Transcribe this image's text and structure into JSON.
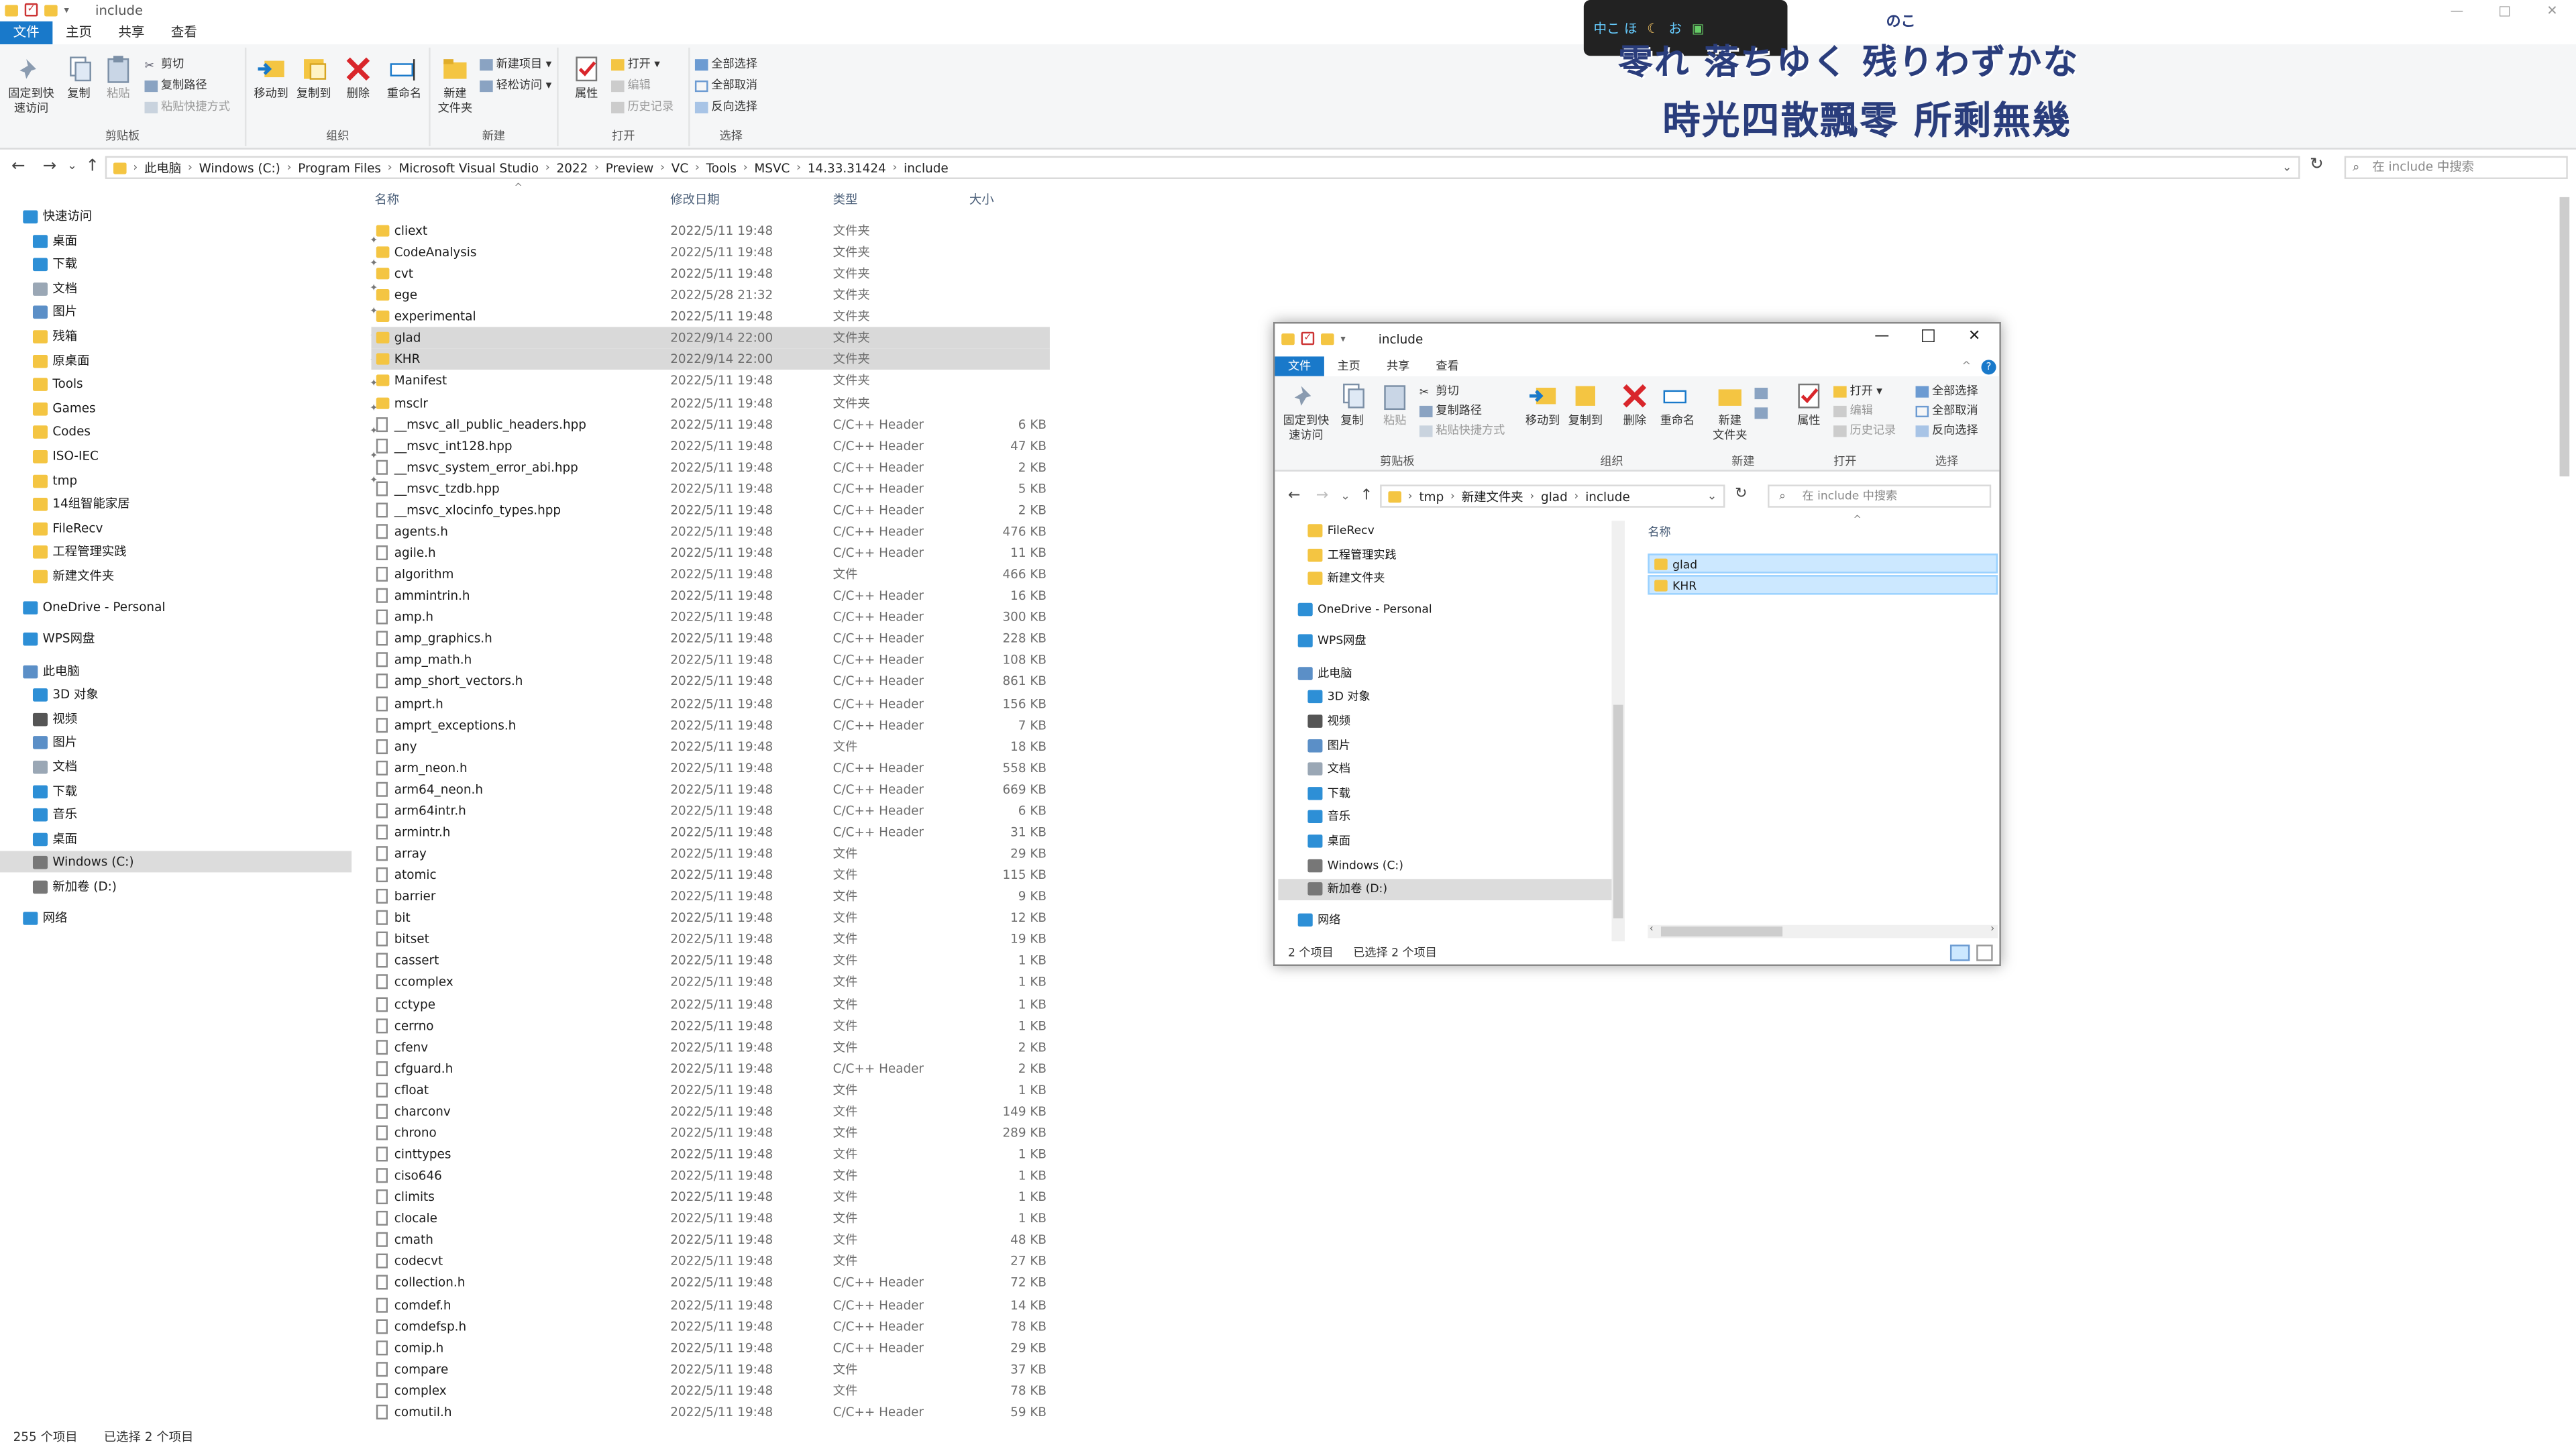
{
  "window": {
    "title": "include"
  },
  "ribbon_tabs": [
    "文件",
    "主页",
    "共享",
    "查看"
  ],
  "ribbon": {
    "clipboard": {
      "label": "剪贴板",
      "pin": "固定到快\n速访问",
      "copy": "复制",
      "paste": "粘贴",
      "cut": "剪切",
      "copy_path": "复制路径",
      "paste_shortcut": "粘贴快捷方式"
    },
    "organize": {
      "label": "组织",
      "move_to": "移动到",
      "copy_to": "复制到",
      "delete": "删除",
      "rename": "重命名"
    },
    "new": {
      "label": "新建",
      "new_folder": "新建\n文件夹",
      "new_item": "新建项目 ▾",
      "easy_access": "轻松访问 ▾"
    },
    "open": {
      "label": "打开",
      "properties": "属性",
      "open": "打开 ▾",
      "edit": "编辑",
      "history": "历史记录"
    },
    "select": {
      "label": "选择",
      "select_all": "全部选择",
      "select_none": "全部取消",
      "invert": "反向选择"
    }
  },
  "address": {
    "crumbs": [
      "此电脑",
      "Windows (C:)",
      "Program Files",
      "Microsoft Visual Studio",
      "2022",
      "Preview",
      "VC",
      "Tools",
      "MSVC",
      "14.33.31424",
      "include"
    ],
    "search_placeholder": "在 include 中搜索"
  },
  "sidebar": {
    "quick_access": "快速访问",
    "pinned": [
      {
        "label": "桌面",
        "icon": "desktop-icon"
      },
      {
        "label": "下载",
        "icon": "download-icon"
      },
      {
        "label": "文档",
        "icon": "document-icon"
      },
      {
        "label": "图片",
        "icon": "picture-icon"
      },
      {
        "label": "残箱",
        "icon": "folder-icon"
      },
      {
        "label": "原桌面",
        "icon": "folder-icon"
      },
      {
        "label": "Tools",
        "icon": "folder-icon"
      },
      {
        "label": "Games",
        "icon": "folder-icon"
      },
      {
        "label": "Codes",
        "icon": "folder-icon"
      },
      {
        "label": "ISO-IEC",
        "icon": "folder-icon"
      },
      {
        "label": "tmp",
        "icon": "folder-icon"
      }
    ],
    "unpinned": [
      "14组智能家居",
      "FileRecv",
      "工程管理实践",
      "新建文件夹"
    ],
    "onedrive": "OneDrive - Personal",
    "wps": "WPS网盘",
    "this_pc": "此电脑",
    "pc_items": [
      "3D 对象",
      "视频",
      "图片",
      "文档",
      "下载",
      "音乐",
      "桌面",
      "Windows (C:)",
      "新加卷 (D:)"
    ],
    "network": "网络"
  },
  "columns": {
    "name": "名称",
    "date": "修改日期",
    "type": "类型",
    "size": "大小"
  },
  "files": [
    [
      "cliext",
      "2022/5/11 19:48",
      "文件夹",
      "",
      "d"
    ],
    [
      "CodeAnalysis",
      "2022/5/11 19:48",
      "文件夹",
      "",
      "d"
    ],
    [
      "cvt",
      "2022/5/11 19:48",
      "文件夹",
      "",
      "d"
    ],
    [
      "ege",
      "2022/5/28 21:32",
      "文件夹",
      "",
      "d"
    ],
    [
      "experimental",
      "2022/5/11 19:48",
      "文件夹",
      "",
      "d"
    ],
    [
      "glad",
      "2022/9/14 22:00",
      "文件夹",
      "",
      "ds"
    ],
    [
      "KHR",
      "2022/9/14 22:00",
      "文件夹",
      "",
      "ds"
    ],
    [
      "Manifest",
      "2022/5/11 19:48",
      "文件夹",
      "",
      "d"
    ],
    [
      "msclr",
      "2022/5/11 19:48",
      "文件夹",
      "",
      "d"
    ],
    [
      "__msvc_all_public_headers.hpp",
      "2022/5/11 19:48",
      "C/C++ Header",
      "6 KB",
      "f"
    ],
    [
      "__msvc_int128.hpp",
      "2022/5/11 19:48",
      "C/C++ Header",
      "47 KB",
      "f"
    ],
    [
      "__msvc_system_error_abi.hpp",
      "2022/5/11 19:48",
      "C/C++ Header",
      "2 KB",
      "f"
    ],
    [
      "__msvc_tzdb.hpp",
      "2022/5/11 19:48",
      "C/C++ Header",
      "5 KB",
      "f"
    ],
    [
      "__msvc_xlocinfo_types.hpp",
      "2022/5/11 19:48",
      "C/C++ Header",
      "2 KB",
      "f"
    ],
    [
      "agents.h",
      "2022/5/11 19:48",
      "C/C++ Header",
      "476 KB",
      "f"
    ],
    [
      "agile.h",
      "2022/5/11 19:48",
      "C/C++ Header",
      "11 KB",
      "f"
    ],
    [
      "algorithm",
      "2022/5/11 19:48",
      "文件",
      "466 KB",
      "f"
    ],
    [
      "ammintrin.h",
      "2022/5/11 19:48",
      "C/C++ Header",
      "16 KB",
      "f"
    ],
    [
      "amp.h",
      "2022/5/11 19:48",
      "C/C++ Header",
      "300 KB",
      "f"
    ],
    [
      "amp_graphics.h",
      "2022/5/11 19:48",
      "C/C++ Header",
      "228 KB",
      "f"
    ],
    [
      "amp_math.h",
      "2022/5/11 19:48",
      "C/C++ Header",
      "108 KB",
      "f"
    ],
    [
      "amp_short_vectors.h",
      "2022/5/11 19:48",
      "C/C++ Header",
      "861 KB",
      "f"
    ],
    [
      "amprt.h",
      "2022/5/11 19:48",
      "C/C++ Header",
      "156 KB",
      "f"
    ],
    [
      "amprt_exceptions.h",
      "2022/5/11 19:48",
      "C/C++ Header",
      "7 KB",
      "f"
    ],
    [
      "any",
      "2022/5/11 19:48",
      "文件",
      "18 KB",
      "f"
    ],
    [
      "arm_neon.h",
      "2022/5/11 19:48",
      "C/C++ Header",
      "558 KB",
      "f"
    ],
    [
      "arm64_neon.h",
      "2022/5/11 19:48",
      "C/C++ Header",
      "669 KB",
      "f"
    ],
    [
      "arm64intr.h",
      "2022/5/11 19:48",
      "C/C++ Header",
      "6 KB",
      "f"
    ],
    [
      "armintr.h",
      "2022/5/11 19:48",
      "C/C++ Header",
      "31 KB",
      "f"
    ],
    [
      "array",
      "2022/5/11 19:48",
      "文件",
      "29 KB",
      "f"
    ],
    [
      "atomic",
      "2022/5/11 19:48",
      "文件",
      "115 KB",
      "f"
    ],
    [
      "barrier",
      "2022/5/11 19:48",
      "文件",
      "9 KB",
      "f"
    ],
    [
      "bit",
      "2022/5/11 19:48",
      "文件",
      "12 KB",
      "f"
    ],
    [
      "bitset",
      "2022/5/11 19:48",
      "文件",
      "19 KB",
      "f"
    ],
    [
      "cassert",
      "2022/5/11 19:48",
      "文件",
      "1 KB",
      "f"
    ],
    [
      "ccomplex",
      "2022/5/11 19:48",
      "文件",
      "1 KB",
      "f"
    ],
    [
      "cctype",
      "2022/5/11 19:48",
      "文件",
      "1 KB",
      "f"
    ],
    [
      "cerrno",
      "2022/5/11 19:48",
      "文件",
      "1 KB",
      "f"
    ],
    [
      "cfenv",
      "2022/5/11 19:48",
      "文件",
      "2 KB",
      "f"
    ],
    [
      "cfguard.h",
      "2022/5/11 19:48",
      "C/C++ Header",
      "2 KB",
      "f"
    ],
    [
      "cfloat",
      "2022/5/11 19:48",
      "文件",
      "1 KB",
      "f"
    ],
    [
      "charconv",
      "2022/5/11 19:48",
      "文件",
      "149 KB",
      "f"
    ],
    [
      "chrono",
      "2022/5/11 19:48",
      "文件",
      "289 KB",
      "f"
    ],
    [
      "cinttypes",
      "2022/5/11 19:48",
      "文件",
      "1 KB",
      "f"
    ],
    [
      "ciso646",
      "2022/5/11 19:48",
      "文件",
      "1 KB",
      "f"
    ],
    [
      "climits",
      "2022/5/11 19:48",
      "文件",
      "1 KB",
      "f"
    ],
    [
      "clocale",
      "2022/5/11 19:48",
      "文件",
      "1 KB",
      "f"
    ],
    [
      "cmath",
      "2022/5/11 19:48",
      "文件",
      "48 KB",
      "f"
    ],
    [
      "codecvt",
      "2022/5/11 19:48",
      "文件",
      "27 KB",
      "f"
    ],
    [
      "collection.h",
      "2022/5/11 19:48",
      "C/C++ Header",
      "72 KB",
      "f"
    ],
    [
      "comdef.h",
      "2022/5/11 19:48",
      "C/C++ Header",
      "14 KB",
      "f"
    ],
    [
      "comdefsp.h",
      "2022/5/11 19:48",
      "C/C++ Header",
      "78 KB",
      "f"
    ],
    [
      "comip.h",
      "2022/5/11 19:48",
      "C/C++ Header",
      "29 KB",
      "f"
    ],
    [
      "compare",
      "2022/5/11 19:48",
      "文件",
      "37 KB",
      "f"
    ],
    [
      "complex",
      "2022/5/11 19:48",
      "文件",
      "78 KB",
      "f"
    ],
    [
      "comutil.h",
      "2022/5/11 19:48",
      "C/C++ Header",
      "59 KB",
      "f"
    ]
  ],
  "status": {
    "count": "255 个项目",
    "selected": "已选择 2 个项目"
  },
  "lyrics": {
    "line1": "零れ 落ちゆく 残りわずかな",
    "ruby": "のこ",
    "line2": "時光四散飄零 所剩無幾",
    "bar_left": "中こ ほ",
    "bar_mid": "お"
  },
  "window2": {
    "title": "include",
    "crumbs": [
      "tmp",
      "新建文件夹",
      "glad",
      "include"
    ],
    "search_placeholder": "在 include 中搜索",
    "nav_top": [
      "FileRecv",
      "工程管理实践",
      "新建文件夹"
    ],
    "onedrive": "OneDrive - Personal",
    "wps": "WPS网盘",
    "this_pc": "此电脑",
    "pc_items": [
      "3D 对象",
      "视频",
      "图片",
      "文档",
      "下载",
      "音乐",
      "桌面",
      "Windows (C:)",
      "新加卷 (D:)"
    ],
    "network": "网络",
    "col_name": "名称",
    "items": [
      "glad",
      "KHR"
    ],
    "status_count": "2 个项目",
    "status_selected": "已选择 2 个项目"
  },
  "colors": {
    "accent": "#1979ca",
    "folder": "#f4c542",
    "selection": "#cce8ff",
    "lyric": "#2a3d7c"
  }
}
